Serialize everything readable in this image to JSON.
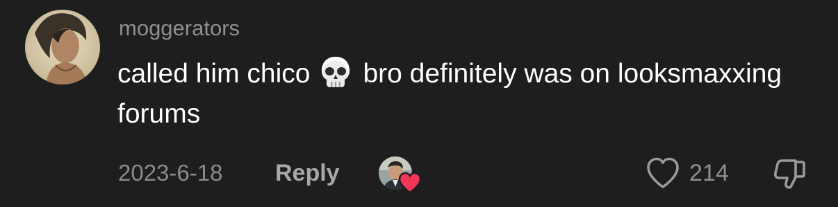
{
  "comment": {
    "username": "moggerators",
    "text_before_emoji": "called him chico",
    "emoji": "skull-emoji",
    "text_after_emoji": "bro definitely was on looksmaxxing forums",
    "date": "2023-6-18",
    "reply_label": "Reply",
    "like_count": "214",
    "liked_by_creator": true
  },
  "icons": {
    "like": "heart-outline-icon",
    "dislike": "thumbs-down-outline-icon",
    "creator_heart": "heart-filled-icon"
  },
  "colors": {
    "background": "#1e1e1e",
    "text_primary": "#ffffff",
    "text_secondary": "#8f8f8f",
    "creator_heart": "#f0375a"
  }
}
